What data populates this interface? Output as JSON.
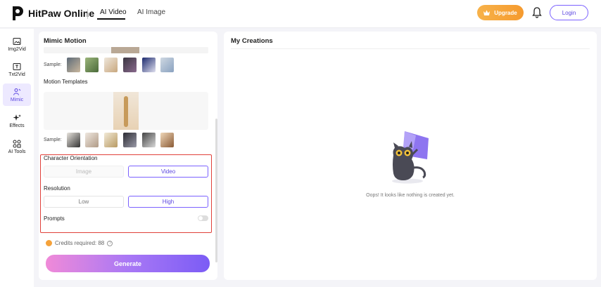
{
  "header": {
    "brand": "HitPaw Online",
    "tabs": [
      {
        "label": "AI Video",
        "active": true
      },
      {
        "label": "AI Image",
        "active": false
      }
    ],
    "upgrade_label": "Upgrade",
    "login_label": "Login"
  },
  "sidebar": {
    "items": [
      {
        "label": "Img2Vid",
        "icon": "image-icon"
      },
      {
        "label": "Txt2Vid",
        "icon": "text-icon"
      },
      {
        "label": "Mimic",
        "icon": "mimic-icon",
        "active": true
      },
      {
        "label": "Effects",
        "icon": "sparkle-icon"
      },
      {
        "label": "AI Tools",
        "icon": "grid-icon"
      }
    ]
  },
  "panel": {
    "title": "Mimic Motion",
    "sample_label": "Sample:",
    "motion_templates_label": "Motion Templates",
    "character_orientation": {
      "label": "Character Orientation",
      "options": [
        "Image",
        "Video"
      ],
      "selected": "Video"
    },
    "resolution": {
      "label": "Resolution",
      "options": [
        "Low",
        "High"
      ],
      "selected": "High"
    },
    "prompts_label": "Prompts",
    "prompts_enabled": false,
    "credits_label": "Credits required: 88",
    "generate_label": "Generate"
  },
  "creations": {
    "title": "My Creations",
    "empty_message": "Oops! It looks like nothing is created yet."
  },
  "colors": {
    "accent": "#7b61ff",
    "upgrade": "#f59a2e",
    "highlight_border": "#e0403a"
  }
}
